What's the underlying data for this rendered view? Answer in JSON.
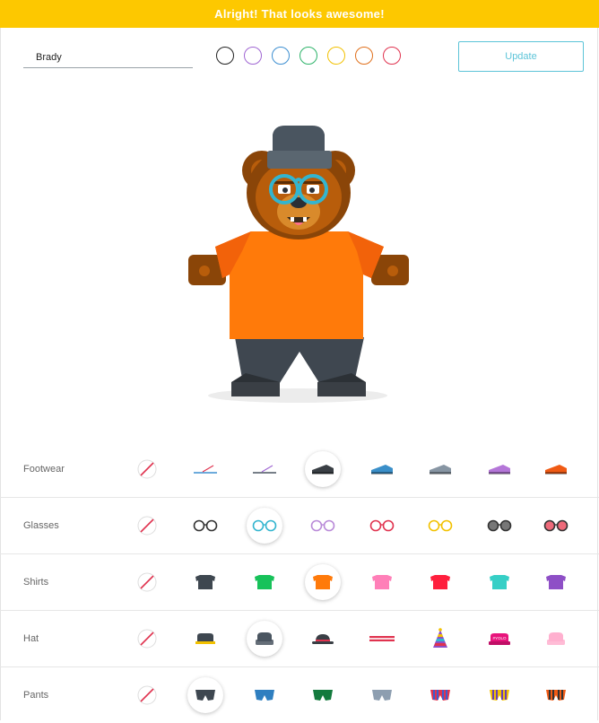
{
  "banner": {
    "text": "Alright! That looks awesome!"
  },
  "name_input": {
    "value": "Brady"
  },
  "swatches": [
    {
      "name": "black",
      "color": "#222222"
    },
    {
      "name": "purple",
      "color": "#a067d3"
    },
    {
      "name": "blue",
      "color": "#3d8fd1"
    },
    {
      "name": "green",
      "color": "#2db36a"
    },
    {
      "name": "yellow",
      "color": "#f2c100"
    },
    {
      "name": "orange",
      "color": "#e0701c"
    },
    {
      "name": "red",
      "color": "#e0334f"
    }
  ],
  "update_button": {
    "label": "Update"
  },
  "categories": [
    {
      "label": "Footwear",
      "selected": 3,
      "options": [
        {
          "icon": "none-icon"
        },
        {
          "icon": "sandal-icon",
          "color": "#3d8fd1",
          "accent": "#e0334f"
        },
        {
          "icon": "sandal-icon",
          "color": "#4a5560",
          "accent": "#a067d3"
        },
        {
          "icon": "shoe-icon",
          "color": "#3a3f45"
        },
        {
          "icon": "shoe-icon",
          "color": "#3a8fc9"
        },
        {
          "icon": "shoe-icon",
          "color": "#8795a3"
        },
        {
          "icon": "shoe-icon",
          "color": "#b476d8"
        },
        {
          "icon": "shoe-icon",
          "color": "#f05a14"
        }
      ]
    },
    {
      "label": "Glasses",
      "selected": 2,
      "options": [
        {
          "icon": "none-icon"
        },
        {
          "icon": "glasses-icon",
          "color": "#333333"
        },
        {
          "icon": "glasses-icon",
          "color": "#33b5cf"
        },
        {
          "icon": "glasses-icon",
          "color": "#b98ad8"
        },
        {
          "icon": "glasses-icon",
          "color": "#e0334f"
        },
        {
          "icon": "glasses-icon",
          "color": "#f2c100"
        },
        {
          "icon": "sunglasses-icon",
          "color": "#333333",
          "fill": "#777777"
        },
        {
          "icon": "sunglasses-icon",
          "color": "#333333",
          "fill": "#ee6a7a"
        }
      ]
    },
    {
      "label": "Shirts",
      "selected": 3,
      "options": [
        {
          "icon": "none-icon"
        },
        {
          "icon": "shirt-icon",
          "color": "#3e4750"
        },
        {
          "icon": "shirt-icon",
          "color": "#17c25a"
        },
        {
          "icon": "shirt-icon",
          "color": "#ff7a0a"
        },
        {
          "icon": "shirt-icon",
          "color": "#ff7fb8"
        },
        {
          "icon": "shirt-icon",
          "color": "#ff1f3d"
        },
        {
          "icon": "shirt-icon",
          "color": "#36cfc6"
        },
        {
          "icon": "shirt-icon",
          "color": "#8e4fc6"
        }
      ]
    },
    {
      "label": "Hat",
      "selected": 2,
      "options": [
        {
          "icon": "none-icon"
        },
        {
          "icon": "cap-icon",
          "color": "#3e4750",
          "accent": "#f2c100"
        },
        {
          "icon": "beanie-icon",
          "color": "#4a5560"
        },
        {
          "icon": "bowler-icon",
          "color": "#3a3f45",
          "accent": "#e0334f"
        },
        {
          "icon": "headband-icon",
          "color": "#e0334f"
        },
        {
          "icon": "party-hat-icon",
          "color": "#8e4fc6"
        },
        {
          "icon": "yolo-cap-icon",
          "color": "#e8147c",
          "text": "#YOLO"
        },
        {
          "icon": "beanie-icon",
          "color": "#ffb0cf"
        }
      ]
    },
    {
      "label": "Pants",
      "selected": 1,
      "options": [
        {
          "icon": "none-icon"
        },
        {
          "icon": "pants-icon",
          "color": "#3e4750"
        },
        {
          "icon": "pants-icon",
          "color": "#2f7fc0"
        },
        {
          "icon": "pants-icon",
          "color": "#137a3d"
        },
        {
          "icon": "pants-icon",
          "color": "#8d9eb0"
        },
        {
          "icon": "striped-pants-icon",
          "color": "#e0334f",
          "accent": "#3b5ed0"
        },
        {
          "icon": "striped-pants-icon",
          "color": "#f2c100",
          "accent": "#6a3fb5"
        },
        {
          "icon": "striped-pants-icon",
          "color": "#f05a14",
          "accent": "#333333"
        }
      ]
    }
  ]
}
